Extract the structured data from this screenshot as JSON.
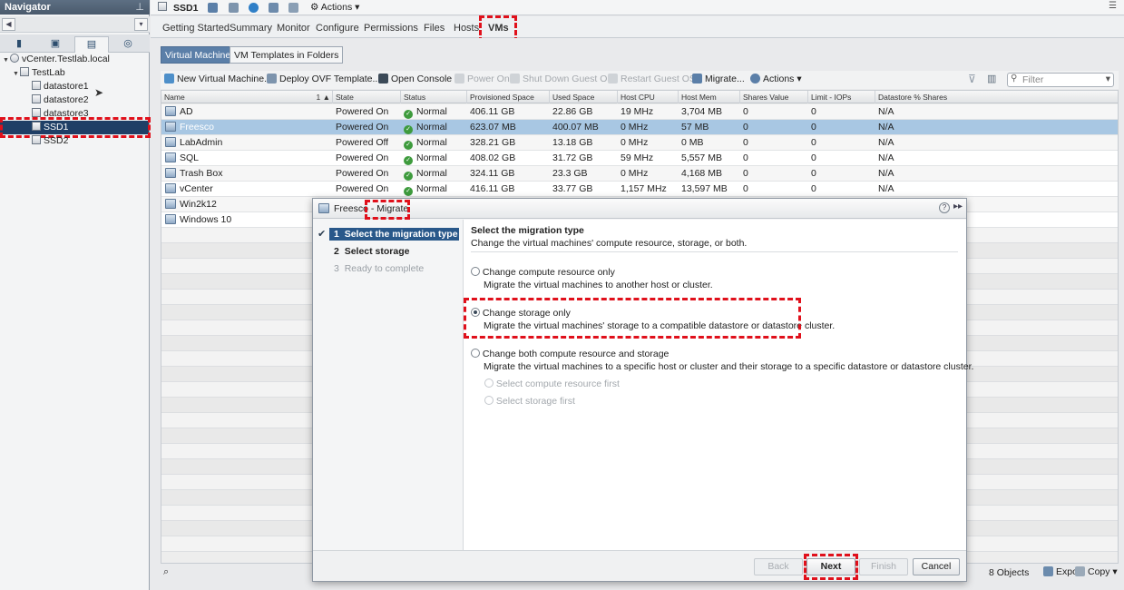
{
  "navigator": {
    "title": "Navigator",
    "tree": {
      "root": "vCenter.Testlab.local",
      "datacenter": "TestLab",
      "datastores": [
        "datastore1",
        "datastore2",
        "datastore3",
        "SSD1",
        "SSD2"
      ]
    }
  },
  "header": {
    "object_name": "SSD1",
    "actions_label": "Actions"
  },
  "tabs": [
    "Getting Started",
    "Summary",
    "Monitor",
    "Configure",
    "Permissions",
    "Files",
    "Hosts",
    "VMs"
  ],
  "subtabs": [
    "Virtual Machines",
    "VM Templates in Folders"
  ],
  "toolbar": {
    "new_vm": "New Virtual Machine...",
    "deploy_ovf": "Deploy OVF Template...",
    "open_console": "Open Console",
    "power_on": "Power On",
    "shutdown_guest": "Shut Down Guest OS",
    "restart_guest": "Restart Guest OS",
    "migrate": "Migrate...",
    "actions": "Actions",
    "filter_placeholder": "Filter"
  },
  "grid": {
    "columns": [
      "Name",
      "State",
      "Status",
      "Provisioned Space",
      "Used Space",
      "Host CPU",
      "Host Mem",
      "Shares Value",
      "Limit - IOPs",
      "Datastore % Shares"
    ],
    "sort_indicator": "1 ▲",
    "rows": [
      {
        "name": "AD",
        "state": "Powered On",
        "status": "Normal",
        "prov": "406.11 GB",
        "used": "22.86 GB",
        "cpu": "19 MHz",
        "mem": "3,704 MB",
        "shares": "0",
        "limit": "0",
        "ds": "N/A"
      },
      {
        "name": "Freesco",
        "state": "Powered On",
        "status": "Normal",
        "prov": "623.07 MB",
        "used": "400.07 MB",
        "cpu": "0 MHz",
        "mem": "57 MB",
        "shares": "0",
        "limit": "0",
        "ds": "N/A"
      },
      {
        "name": "LabAdmin",
        "state": "Powered Off",
        "status": "Normal",
        "prov": "328.21 GB",
        "used": "13.18 GB",
        "cpu": "0 MHz",
        "mem": "0 MB",
        "shares": "0",
        "limit": "0",
        "ds": "N/A"
      },
      {
        "name": "SQL",
        "state": "Powered On",
        "status": "Normal",
        "prov": "408.02 GB",
        "used": "31.72 GB",
        "cpu": "59 MHz",
        "mem": "5,557 MB",
        "shares": "0",
        "limit": "0",
        "ds": "N/A"
      },
      {
        "name": "Trash Box",
        "state": "Powered On",
        "status": "Normal",
        "prov": "324.11 GB",
        "used": "23.3 GB",
        "cpu": "0 MHz",
        "mem": "4,168 MB",
        "shares": "0",
        "limit": "0",
        "ds": "N/A"
      },
      {
        "name": "vCenter",
        "state": "Powered On",
        "status": "Normal",
        "prov": "416.11 GB",
        "used": "33.77 GB",
        "cpu": "1,157 MHz",
        "mem": "13,597 MB",
        "shares": "0",
        "limit": "0",
        "ds": "N/A"
      },
      {
        "name": "Win2k12",
        "state": "",
        "status": "",
        "prov": "",
        "used": "",
        "cpu": "",
        "mem": "",
        "shares": "",
        "limit": "",
        "ds": ""
      },
      {
        "name": "Windows 10",
        "state": "",
        "status": "",
        "prov": "",
        "used": "",
        "cpu": "",
        "mem": "",
        "shares": "",
        "limit": "",
        "ds": ""
      }
    ]
  },
  "statusbar": {
    "count": "8 Objects",
    "export": "Export",
    "copy": "Copy"
  },
  "dialog": {
    "title": "Freesco - Migrate",
    "steps": [
      {
        "num": "1",
        "label": "Select the migration type"
      },
      {
        "num": "2",
        "label": "Select storage"
      },
      {
        "num": "3",
        "label": "Ready to complete"
      }
    ],
    "heading": "Select the migration type",
    "subheading": "Change the virtual machines' compute resource, storage, or both.",
    "options": [
      {
        "label": "Change compute resource only",
        "desc": "Migrate the virtual machines to another host or cluster."
      },
      {
        "label": "Change storage only",
        "desc": "Migrate the virtual machines' storage to a compatible datastore or datastore cluster."
      },
      {
        "label": "Change both compute resource and storage",
        "desc": "Migrate the virtual machines to a specific host or cluster and their storage to a specific datastore or datastore cluster."
      }
    ],
    "suboptions": [
      "Select compute resource first",
      "Select storage first"
    ],
    "buttons": {
      "back": "Back",
      "next": "Next",
      "finish": "Finish",
      "cancel": "Cancel"
    }
  }
}
